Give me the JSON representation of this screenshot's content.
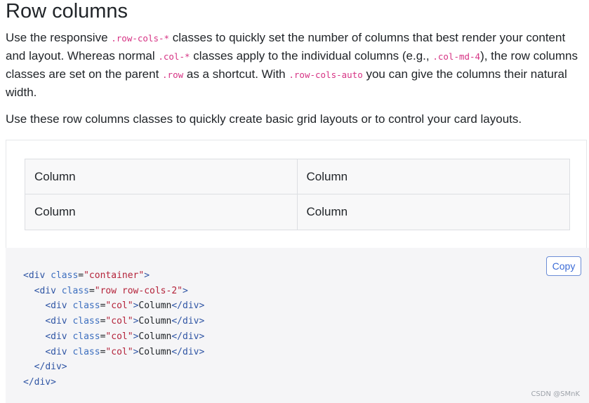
{
  "heading": "Row columns",
  "intro": {
    "t1": "Use the responsive ",
    "c1": ".row-cols-*",
    "t2": " classes to quickly set the number of columns that best render your content and layout. Whereas normal ",
    "c2": ".col-*",
    "t3": " classes apply to the individual columns (e.g., ",
    "c3": ".col-md-4",
    "t4": "), the row columns classes are set on the parent ",
    "c4": ".row",
    "t5": " as a shortcut. With ",
    "c5": ".row-cols-auto",
    "t6": " you can give the columns their natural width."
  },
  "second_paragraph": "Use these row columns classes to quickly create basic grid layouts or to control your card layouts.",
  "example_grid": {
    "cells": [
      "Column",
      "Column",
      "Column",
      "Column"
    ]
  },
  "code_block": {
    "copy_label": "Copy",
    "lines": [
      {
        "indent": "",
        "open": "<",
        "tag": "div",
        "sp": " ",
        "attr": "class",
        "eq": "=",
        "value": "\"container\"",
        "close": ">",
        "text": "",
        "end_tag": ""
      },
      {
        "indent": "  ",
        "open": "<",
        "tag": "div",
        "sp": " ",
        "attr": "class",
        "eq": "=",
        "value": "\"row row-cols-2\"",
        "close": ">",
        "text": "",
        "end_tag": ""
      },
      {
        "indent": "    ",
        "open": "<",
        "tag": "div",
        "sp": " ",
        "attr": "class",
        "eq": "=",
        "value": "\"col\"",
        "close": ">",
        "text": "Column",
        "end_tag": "</div>"
      },
      {
        "indent": "    ",
        "open": "<",
        "tag": "div",
        "sp": " ",
        "attr": "class",
        "eq": "=",
        "value": "\"col\"",
        "close": ">",
        "text": "Column",
        "end_tag": "</div>"
      },
      {
        "indent": "    ",
        "open": "<",
        "tag": "div",
        "sp": " ",
        "attr": "class",
        "eq": "=",
        "value": "\"col\"",
        "close": ">",
        "text": "Column",
        "end_tag": "</div>"
      },
      {
        "indent": "    ",
        "open": "<",
        "tag": "div",
        "sp": " ",
        "attr": "class",
        "eq": "=",
        "value": "\"col\"",
        "close": ">",
        "text": "Column",
        "end_tag": "</div>"
      },
      {
        "indent": "  ",
        "open": "</",
        "tag": "div",
        "sp": "",
        "attr": "",
        "eq": "",
        "value": "",
        "close": ">",
        "text": "",
        "end_tag": ""
      },
      {
        "indent": "",
        "open": "</",
        "tag": "div",
        "sp": "",
        "attr": "",
        "eq": "",
        "value": "",
        "close": ">",
        "text": "",
        "end_tag": ""
      }
    ]
  },
  "watermark": "CSDN @SMnK",
  "colors": {
    "inline_code": "#d63384",
    "copy_button": "#3b6bd6",
    "code_tag": "#2f55a4",
    "code_string": "#b4233a",
    "grid_cell_bg": "#f8f8f9",
    "code_bg": "#f5f5f7"
  }
}
